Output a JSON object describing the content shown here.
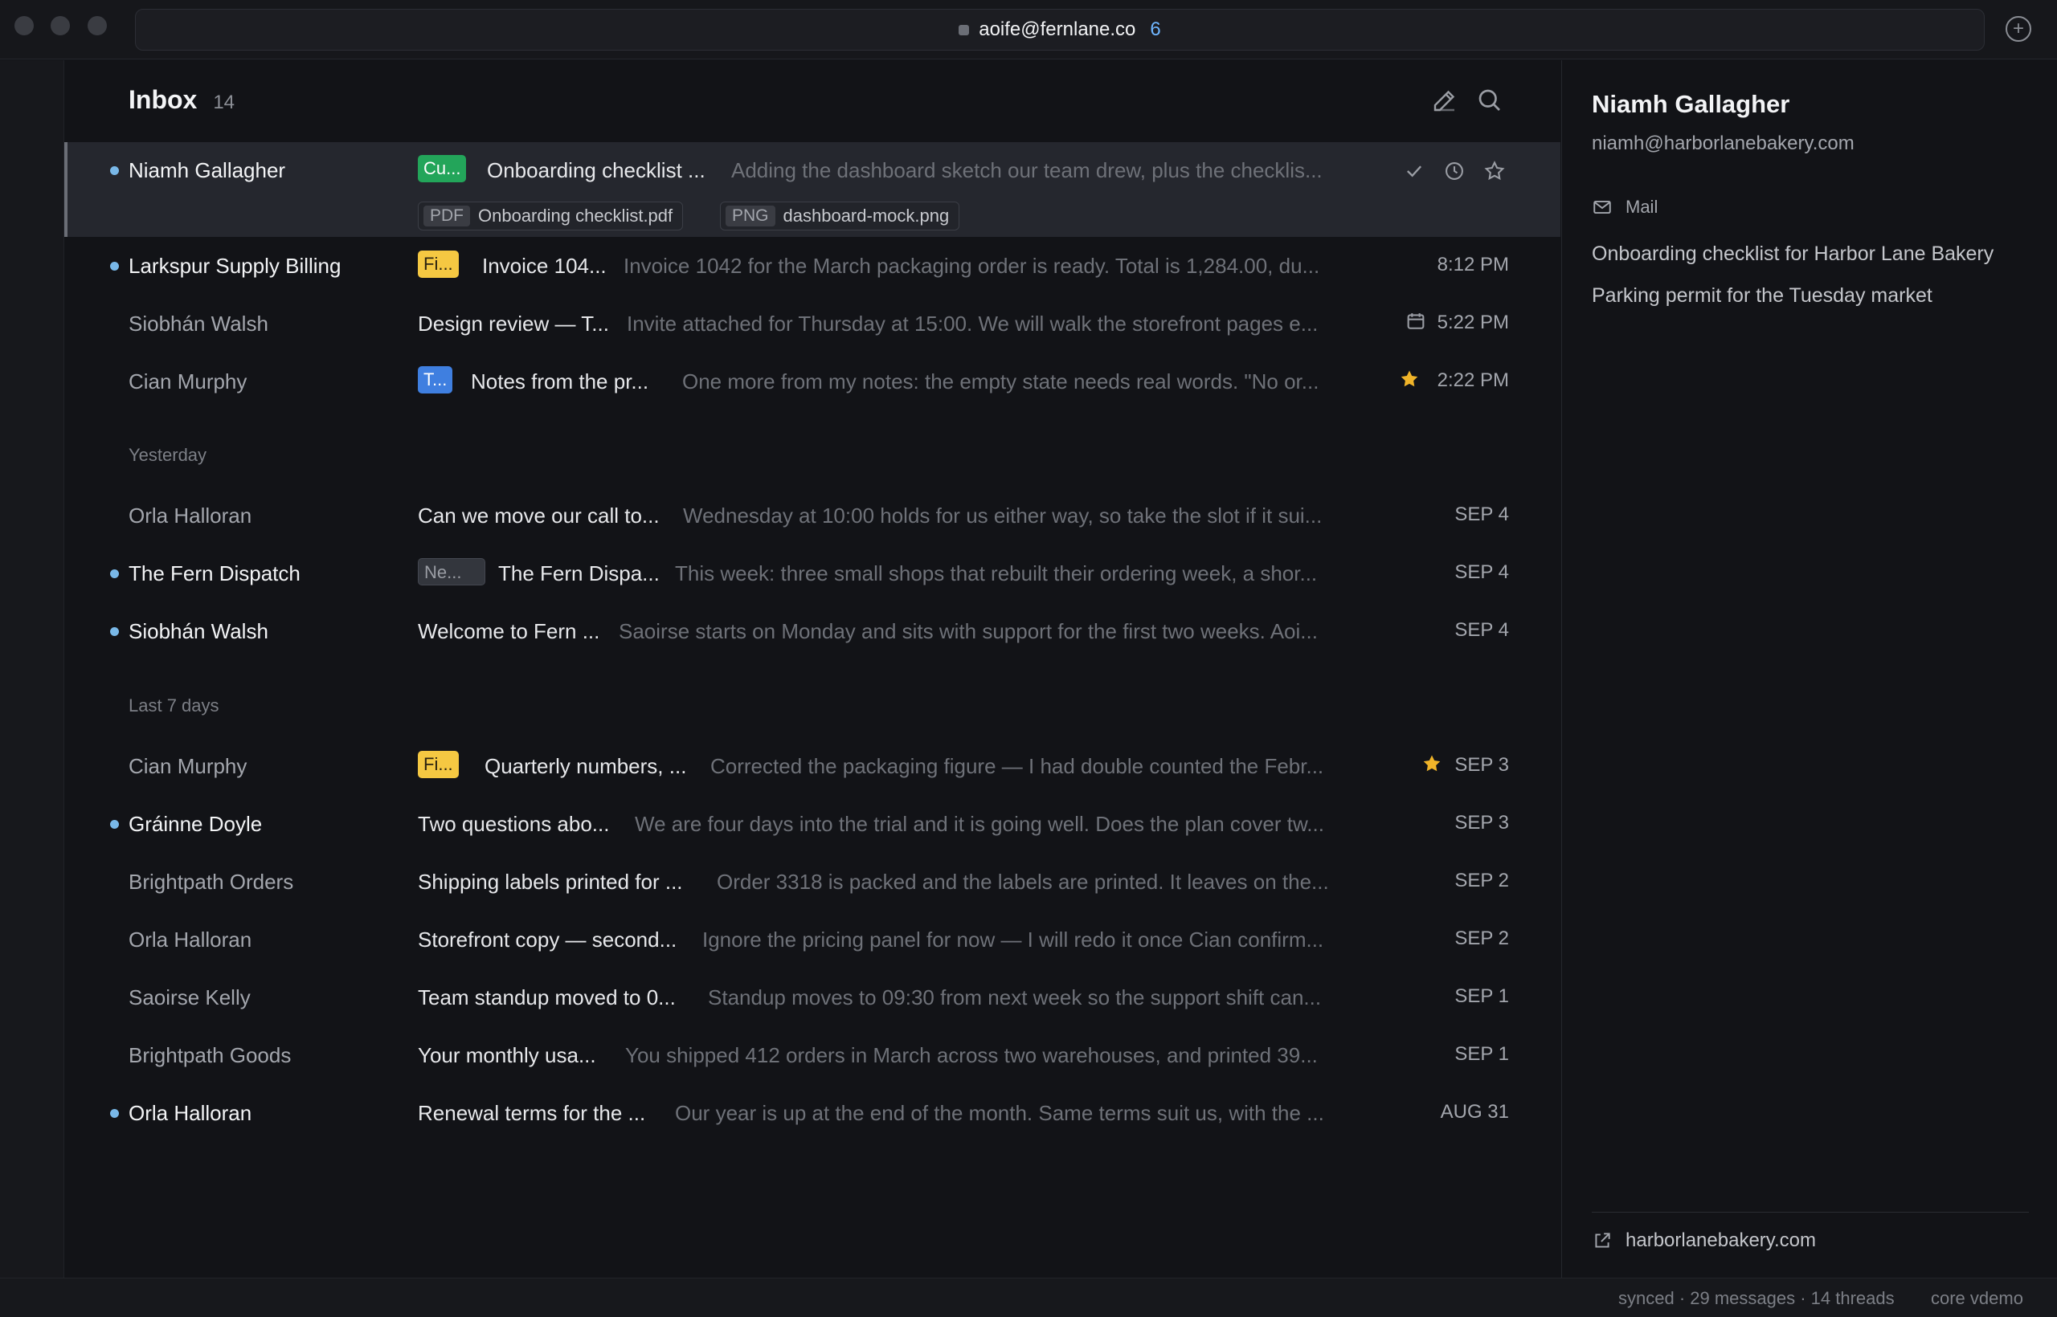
{
  "window": {
    "account": "aoife@fernlane.co",
    "account_badge": "6"
  },
  "inbox": {
    "title": "Inbox",
    "count": "14"
  },
  "selected": {
    "sender": "Niamh Gallagher",
    "label": "Cu...",
    "subject": "Onboarding checklist ...",
    "preview": "Adding the dashboard sketch our team drew, plus the checklis...",
    "attachments": [
      {
        "type": "PDF",
        "name": "Onboarding checklist.pdf"
      },
      {
        "type": "PNG",
        "name": "dashboard-mock.png"
      }
    ]
  },
  "today": [
    {
      "sender": "Larkspur Supply Billing",
      "label": "Fi...",
      "subject": "Invoice 104...",
      "preview": "Invoice 1042 for the March packaging order is ready. Total is 1,284.00, du...",
      "time": "8:12 PM"
    },
    {
      "sender": "Siobhán Walsh",
      "subject": "Design review — T...",
      "preview": "Invite attached for Thursday at 15:00. We will walk the storefront pages e...",
      "time": "5:22 PM"
    },
    {
      "sender": "Cian Murphy",
      "label": "T...",
      "subject": "Notes from the pr...",
      "preview": "One more from my notes: the empty state needs real words. \"No or...",
      "time": "2:22 PM"
    }
  ],
  "sections": {
    "yesterday": "Yesterday",
    "last7": "Last 7 days"
  },
  "yesterday": [
    {
      "sender": "Orla Halloran",
      "subject": "Can we move our call to...",
      "preview": "Wednesday at 10:00 holds for us either way, so take the slot if it sui...",
      "time": "SEP 4"
    },
    {
      "sender": "The Fern Dispatch",
      "label": "Ne...",
      "subject": "The Fern Dispa...",
      "preview": "This week: three small shops that rebuilt their ordering week, a shor...",
      "time": "SEP 4"
    },
    {
      "sender": "Siobhán Walsh",
      "subject": "Welcome to Fern ...",
      "preview": "Saoirse starts on Monday and sits with support for the first two weeks. Aoi...",
      "time": "SEP 4"
    }
  ],
  "last7": [
    {
      "sender": "Cian Murphy",
      "label": "Fi...",
      "subject": "Quarterly numbers, ...",
      "preview": "Corrected the packaging figure — I had double counted the Febr...",
      "time": "SEP 3"
    },
    {
      "sender": "Gráinne Doyle",
      "subject": "Two questions abo...",
      "preview": "We are four days into the trial and it is going well. Does the plan cover tw...",
      "time": "SEP 3"
    },
    {
      "sender": "Brightpath Orders",
      "subject": "Shipping labels printed for ...",
      "preview": "Order 3318 is packed and the labels are printed. It leaves on the...",
      "time": "SEP 2"
    },
    {
      "sender": "Orla Halloran",
      "subject": "Storefront copy — second...",
      "preview": "Ignore the pricing panel for now — I will redo it once Cian confirm...",
      "time": "SEP 2"
    },
    {
      "sender": "Saoirse Kelly",
      "subject": "Team standup moved to 0...",
      "preview": "Standup moves to 09:30 from next week so the support shift can...",
      "time": "SEP 1"
    },
    {
      "sender": "Brightpath Goods",
      "subject": "Your monthly usa...",
      "preview": "You shipped 412 orders in March across two warehouses, and printed 39...",
      "time": "SEP 1"
    },
    {
      "sender": "Orla Halloran",
      "subject": "Renewal terms for the ...",
      "preview": "Our year is up at the end of the month. Same terms suit us, with the ...",
      "time": "AUG 31"
    }
  ],
  "contact": {
    "name": "Niamh Gallagher",
    "email": "niamh@harborlanebakery.com",
    "mail_header": "Mail",
    "threads": [
      "Onboarding checklist for Harbor Lane Bakery",
      "Parking permit for the Tuesday market"
    ],
    "website": "harborlanebakery.com"
  },
  "status": {
    "sync": "synced · 29 messages · 14 threads",
    "build": "core vdemo"
  },
  "colors": {
    "label_green": "#23a55a",
    "label_yellow": "#f5c842",
    "label_blue": "#3f7fe0",
    "label_gray": "#33363d",
    "star": "#f0b429",
    "unread_dot": "#79b8e8"
  }
}
